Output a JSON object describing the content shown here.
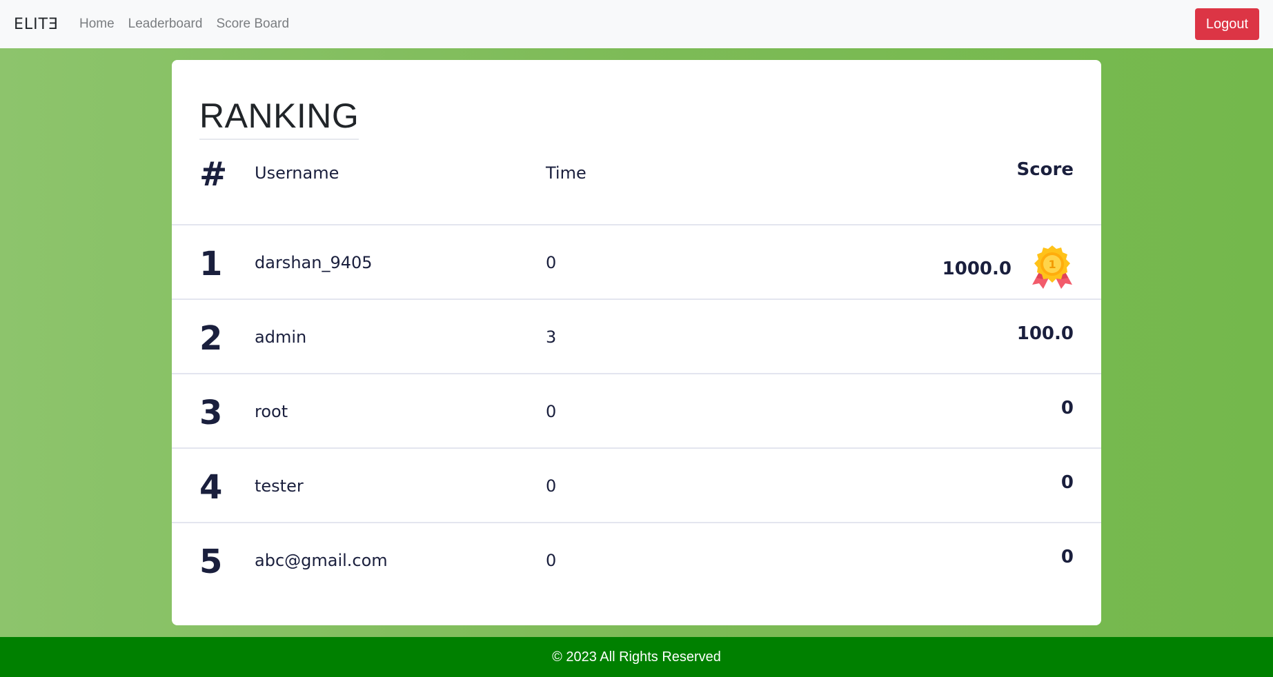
{
  "navbar": {
    "brand": "ELITƎ",
    "links": [
      "Home",
      "Leaderboard",
      "Score Board"
    ],
    "logout_label": "Logout"
  },
  "ranking": {
    "title": "RANKING",
    "columns": {
      "rank": "#",
      "username": "Username",
      "time": "Time",
      "score": "Score"
    },
    "rows": [
      {
        "rank": "1",
        "username": "darshan_9405",
        "time": "0",
        "score": "1000.0",
        "medal": "gold-medal-icon"
      },
      {
        "rank": "2",
        "username": "admin",
        "time": "3",
        "score": "100.0"
      },
      {
        "rank": "3",
        "username": "root",
        "time": "0",
        "score": "0"
      },
      {
        "rank": "4",
        "username": "tester",
        "time": "0",
        "score": "0"
      },
      {
        "rank": "5",
        "username": "abc@gmail.com",
        "time": "0",
        "score": "0"
      }
    ]
  },
  "footer": {
    "text": "© 2023 All Rights Reserved"
  },
  "colors": {
    "footer_bg": "#008000",
    "logout_bg": "#dc3545",
    "text_dark": "#1a1f3d"
  }
}
